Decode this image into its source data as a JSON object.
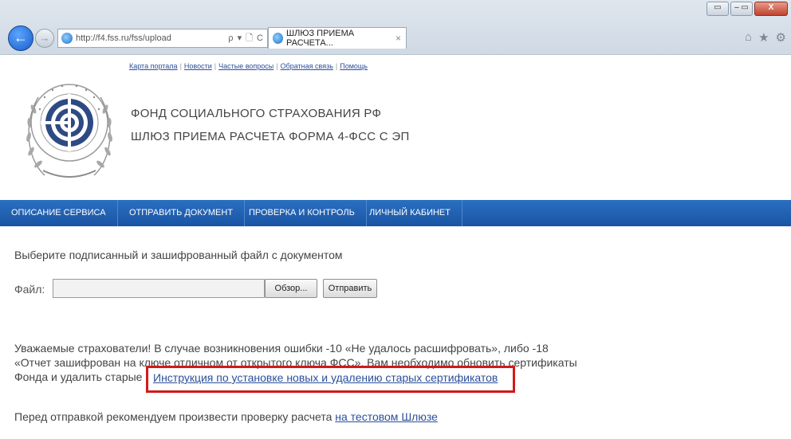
{
  "browser": {
    "address_url": "http://f4.fss.ru/fss/upload",
    "address_tools": "ρ ▾ 🗋 C",
    "tab_title": "ШЛЮЗ ПРИЕМА РАСЧЕТА...",
    "tab_close": "×",
    "back_glyph": "←",
    "forward_glyph": "→",
    "window_controls": {
      "minimize": "▭",
      "maximize": "–  ▭",
      "close": "X"
    },
    "right_icons": [
      "home-icon",
      "star-icon",
      "gear-icon"
    ],
    "right_icon_glyphs": {
      "home": "⌂",
      "star": "★",
      "gear": "⚙"
    }
  },
  "header": {
    "top_links": [
      "Карта портала",
      "Новости",
      "Частые вопросы",
      "Обратная связь",
      "Помощь"
    ],
    "org_line1": "ФОНД СОЦИАЛЬНОГО СТРАХОВАНИЯ РФ",
    "org_line2": "ШЛЮЗ ПРИЕМА РАСЧЕТА ФОРМА 4-ФСС С ЭП"
  },
  "menu": {
    "items": [
      "ОПИСАНИЕ СЕРВИСА",
      "ОТПРАВИТЬ ДОКУМЕНТ",
      "ПРОВЕРКА И КОНТРОЛЬ",
      "ЛИЧНЫЙ КАБИНЕТ"
    ]
  },
  "content": {
    "choose_file_text": "Выберите подписанный и зашифрованный файл с документом",
    "file_label": "Файл:",
    "file_value": "",
    "browse_button": "Обзор...",
    "send_button": "Отправить",
    "notice_line1": "Уважаемые страхователи! В случае возникновения ошибки -10 «Не удалось расшифровать», либо -18",
    "notice_line2": "«Отчет зашифрован на ключе отличном от открытого ключа ФСС», Вам необходимо обновить сертификаты",
    "notice_line3": "Фонда и удалить старые",
    "instruction_link": "Инструкция по установке новых и удалению старых сертификатов",
    "check_text": "Перед отправкой рекомендуем произвести проверку расчета",
    "test_gateway_link": "на тестовом Шлюзе"
  },
  "colors": {
    "menu_bar": "#1f5fb0",
    "link": "#2b4f9b",
    "highlight_border": "#d11a1a"
  }
}
